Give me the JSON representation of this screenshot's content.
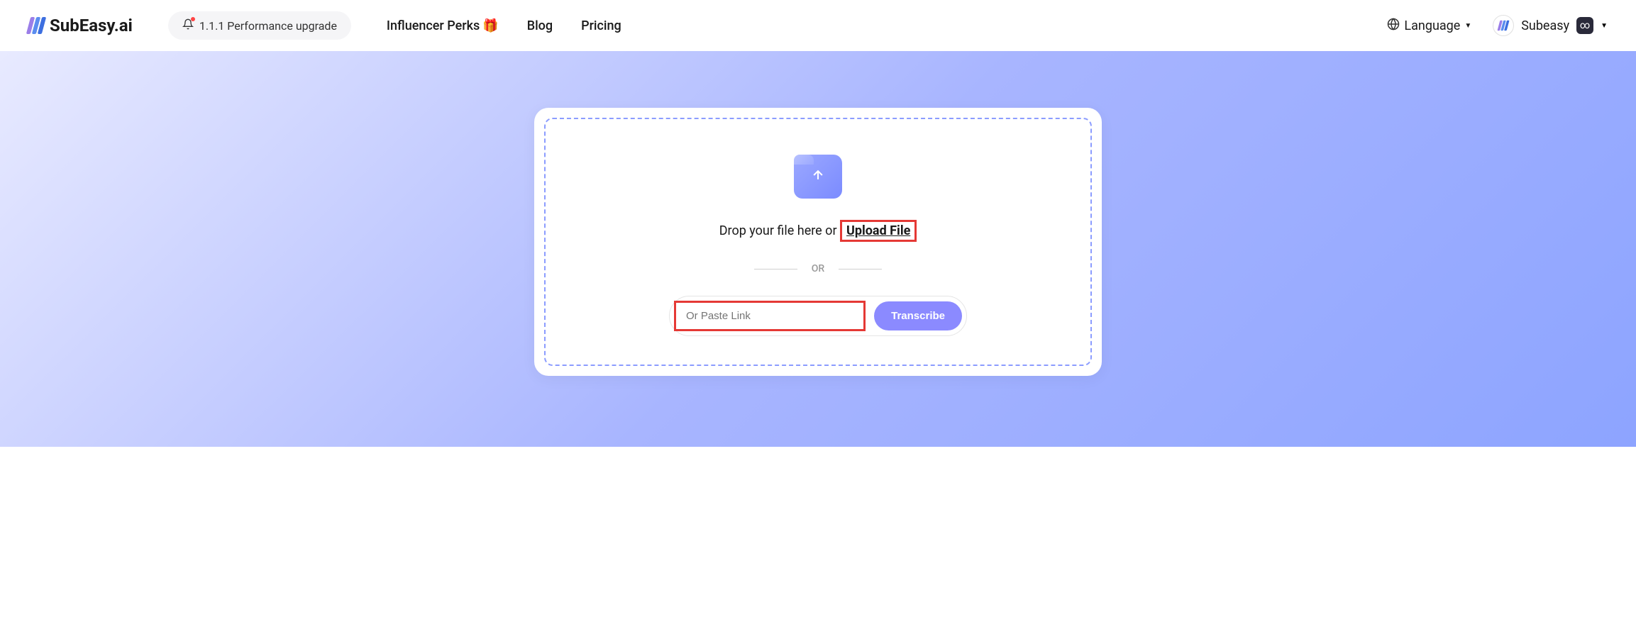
{
  "header": {
    "logo_text": "SubEasy.ai",
    "upgrade_label": "1.1.1 Performance upgrade",
    "nav": {
      "influencer_perks": "Influencer Perks",
      "blog": "Blog",
      "pricing": "Pricing"
    },
    "language_label": "Language",
    "user_name": "Subeasy",
    "user_badge": "∞"
  },
  "upload": {
    "drop_text": "Drop your file here or ",
    "upload_file_link": "Upload File",
    "or_label": "OR",
    "link_placeholder": "Or Paste Link",
    "transcribe_button": "Transcribe"
  }
}
